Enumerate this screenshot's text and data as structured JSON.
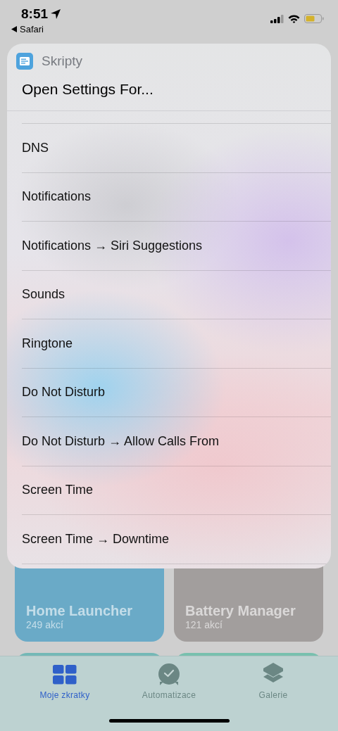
{
  "status_bar": {
    "time": "8:51",
    "back_app": "Safari"
  },
  "sheet": {
    "app_name": "Skripty",
    "title": "Open Settings For...",
    "items": [
      {
        "label": "DNS"
      },
      {
        "label": "Notifications"
      },
      {
        "label": "Notifications → Siri Suggestions"
      },
      {
        "label": "Sounds"
      },
      {
        "label": "Ringtone"
      },
      {
        "label": "Do Not Disturb"
      },
      {
        "label": "Do Not Disturb → Allow Calls From"
      },
      {
        "label": "Screen Time"
      },
      {
        "label": "Screen Time → Downtime"
      }
    ]
  },
  "shortcuts": [
    {
      "title": "Home Launcher",
      "count": "249 akcí",
      "color": "#6aaac7"
    },
    {
      "title": "Battery Manager",
      "count": "121 akcí",
      "color": "#a29e9d"
    },
    {
      "color": "#74b8b6"
    },
    {
      "color": "#78c0ae"
    }
  ],
  "tab_bar": [
    {
      "label": "Moje zkratky",
      "kind": "grid",
      "selected": true
    },
    {
      "label": "Automatizace",
      "kind": "clock",
      "selected": false
    },
    {
      "label": "Galerie",
      "kind": "layers",
      "selected": false
    }
  ]
}
